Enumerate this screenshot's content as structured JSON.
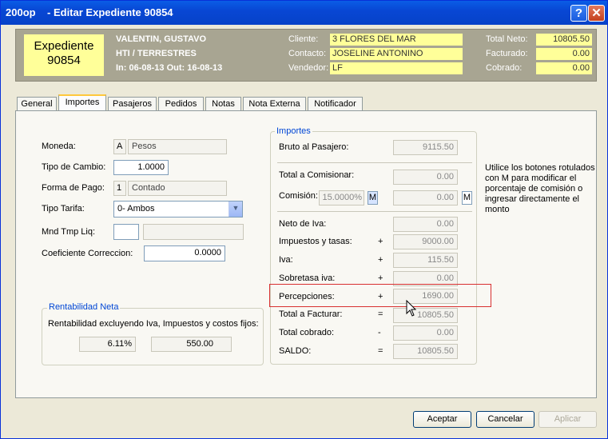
{
  "window": {
    "title": "200op    - Editar Expediente 90854",
    "help_label": "?",
    "close_label": "✕"
  },
  "header": {
    "expediente_label": "Expediente",
    "expediente_number": "90854",
    "client_name": "VALENTIN, GUSTAVO",
    "service": "HTI / TERRESTRES",
    "dates": "In: 06-08-13 Out: 16-08-13",
    "cliente_label": "Cliente:",
    "cliente_value": "3 FLORES DEL MAR",
    "contacto_label": "Contacto:",
    "contacto_value": "JOSELINE ANTONINO",
    "vendedor_label": "Vendedor:",
    "vendedor_value": "LF",
    "total_neto_label": "Total Neto:",
    "total_neto_value": "10805.50",
    "facturado_label": "Facturado:",
    "facturado_value": "0.00",
    "cobrado_label": "Cobrado:",
    "cobrado_value": "0.00"
  },
  "tabs": [
    "General",
    "Importes",
    "Pasajeros",
    "Pedidos",
    "Notas",
    "Nota Externa",
    "Notificador"
  ],
  "left": {
    "moneda_label": "Moneda:",
    "moneda_code": "A",
    "moneda_name": "Pesos",
    "tipo_cambio_label": "Tipo de Cambio:",
    "tipo_cambio_value": "1.0000",
    "forma_pago_label": "Forma de Pago:",
    "forma_pago_code": "1",
    "forma_pago_name": "Contado",
    "tipo_tarifa_label": "Tipo Tarifa:",
    "tipo_tarifa_value": "0- Ambos",
    "mnd_label": "Mnd Tmp Liq:",
    "mnd_value": "",
    "mnd_name": "",
    "coef_label": "Coeficiente Correccion:",
    "coef_value": "0.0000"
  },
  "rentabilidad": {
    "title": "Rentabilidad Neta",
    "text": "Rentabilidad excluyendo Iva, Impuestos y costos fijos:",
    "percent": "6.11%",
    "amount": "550.00"
  },
  "importes": {
    "title": "Importes",
    "bruto_label": "Bruto al Pasajero:",
    "bruto_value": "9115.50",
    "total_comisionar_label": "Total a Comisionar:",
    "total_comisionar_value": "0.00",
    "comision_label": "Comisión:",
    "comision_pct": "15.0000%",
    "comision_value": "0.00",
    "m_label": "M",
    "neto_iva_label": "Neto de Iva:",
    "neto_iva_value": "0.00",
    "impuestos_label": "Impuestos y tasas:",
    "impuestos_sign": "+",
    "impuestos_value": "9000.00",
    "iva_label": "Iva:",
    "iva_sign": "+",
    "iva_value": "115.50",
    "sobretasa_label": "Sobretasa iva:",
    "sobretasa_sign": "+",
    "sobretasa_value": "0.00",
    "percepciones_label": "Percepciones:",
    "percepciones_sign": "+",
    "percepciones_value": "1690.00",
    "total_facturar_label": "Total a Facturar:",
    "total_facturar_sign": "=",
    "total_facturar_value": "10805.50",
    "total_cobrado_label": "Total cobrado:",
    "total_cobrado_sign": "-",
    "total_cobrado_value": "0.00",
    "saldo_label": "SALDO:",
    "saldo_sign": "=",
    "saldo_value": "10805.50"
  },
  "help_text": "Utilice los botones rotulados con M para modificar el porcentaje de comisión o ingresar directamente el monto",
  "buttons": {
    "accept": "Aceptar",
    "cancel": "Cancelar",
    "apply": "Aplicar"
  }
}
